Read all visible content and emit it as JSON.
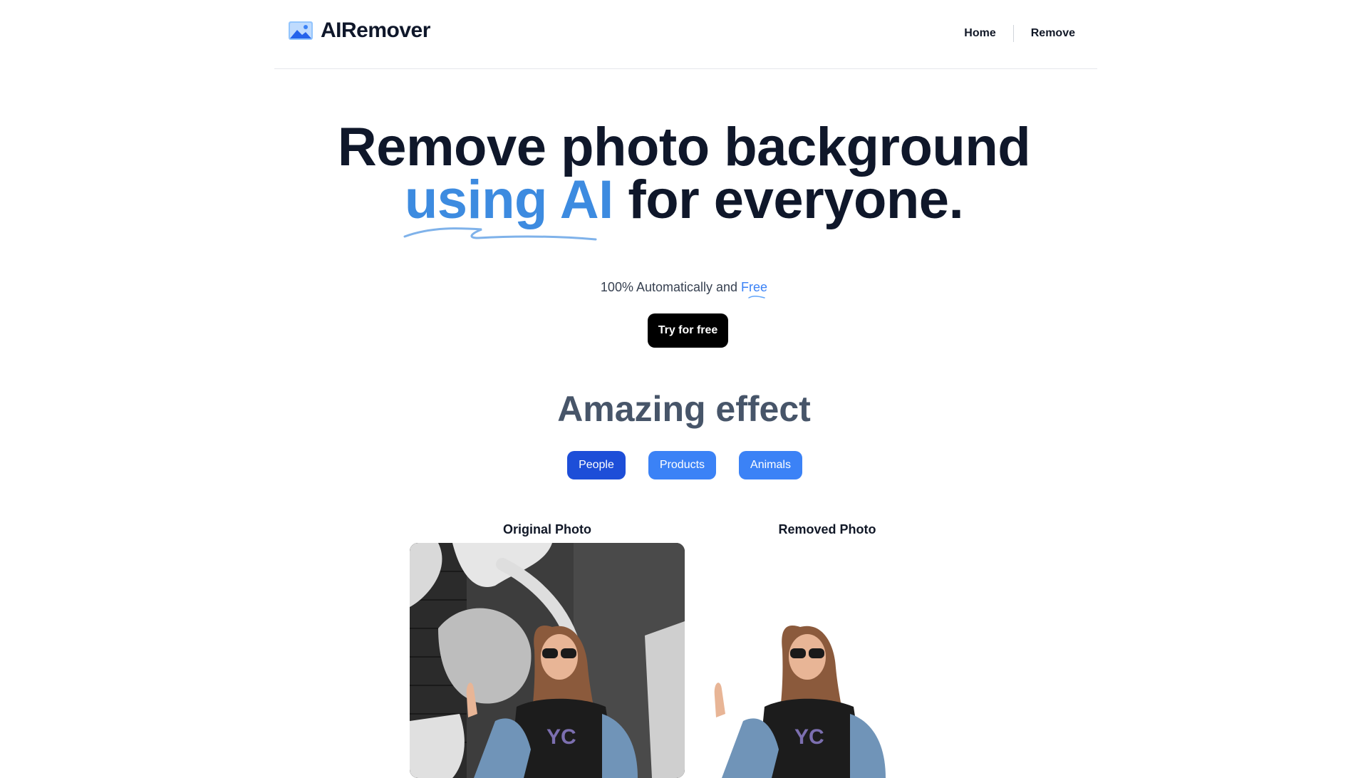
{
  "header": {
    "logo_text": "AIRemover",
    "nav": [
      {
        "label": "Home"
      },
      {
        "label": "Remove"
      }
    ]
  },
  "hero": {
    "title_line1": "Remove photo background",
    "title_highlight": "using AI",
    "title_rest": " for everyone.",
    "subtitle_prefix": "100% Automatically and ",
    "subtitle_highlight": "Free",
    "cta_label": "Try for free"
  },
  "effects": {
    "title": "Amazing effect",
    "tabs": [
      {
        "label": "People",
        "active": true
      },
      {
        "label": "Products",
        "active": false
      },
      {
        "label": "Animals",
        "active": false
      }
    ],
    "original_label": "Original Photo",
    "removed_label": "Removed Photo"
  },
  "colors": {
    "accent": "#3b82f6",
    "accent_dark": "#1d4ed8",
    "heading": "#0f172a",
    "section_heading": "#475569",
    "cta_bg": "#000000"
  },
  "icons": {
    "logo": "image-landscape-icon"
  }
}
